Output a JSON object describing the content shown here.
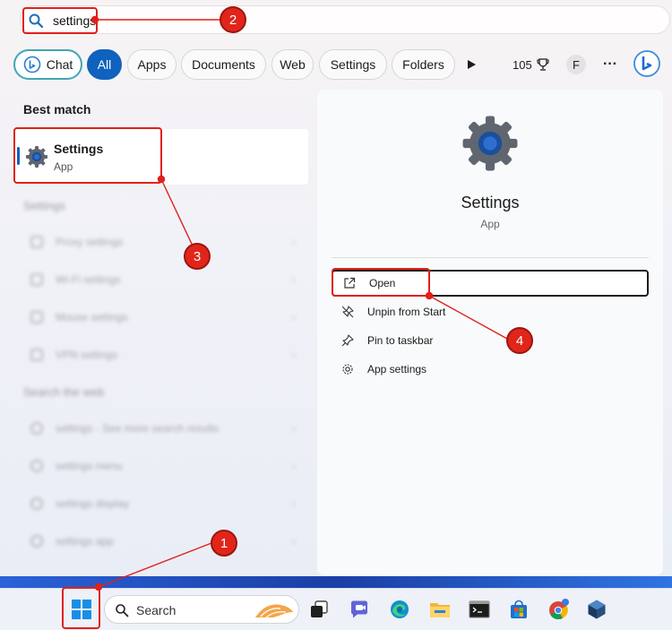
{
  "search": {
    "query": "settings"
  },
  "filters": {
    "chat": "Chat",
    "all": "All",
    "apps": "Apps",
    "documents": "Documents",
    "web": "Web",
    "settings": "Settings",
    "folders": "Folders",
    "points": "105",
    "profile_initial": "F",
    "more": "···"
  },
  "left": {
    "best_match_label": "Best match",
    "best_item": {
      "title": "Settings",
      "subtitle": "App"
    },
    "settings_section": "Settings",
    "settings_rows": [
      "Proxy settings",
      "Wi-Fi settings",
      "Mouse settings",
      "VPN settings"
    ],
    "web_section": "Search the web",
    "web_rows": [
      "settings - See more search results",
      "settings menu",
      "settings display",
      "settings app"
    ]
  },
  "preview": {
    "title": "Settings",
    "subtitle": "App",
    "actions": [
      "Open",
      "Unpin from Start",
      "Pin to taskbar",
      "App settings"
    ]
  },
  "taskbar": {
    "search_label": "Search"
  },
  "annotations": [
    "1",
    "2",
    "3",
    "4"
  ],
  "colors": {
    "accent": "#0f62bd",
    "annotation": "#e1251b"
  }
}
